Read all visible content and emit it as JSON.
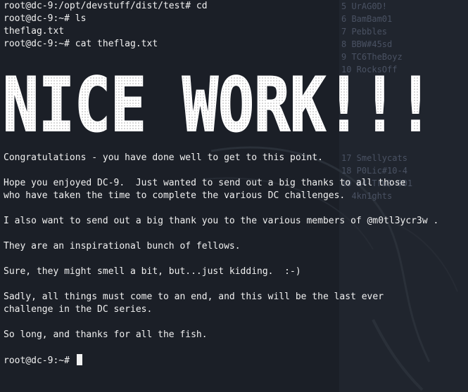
{
  "background_password_list": [
    "5 UrAG0D!",
    "6 BamBam01",
    "7 Pebbles",
    "8 BBW#45sd",
    "9 TC6TheBoyz",
    "10 RocksOff",
    "",
    "",
    "",
    "",
    "",
    "",
    "17 Smellycats",
    "18 P0Lic#10-4",
    "19 B4-Tru3-001",
    "  4kn1ghts"
  ],
  "terminal": {
    "commands": [
      "root@dc-9:/opt/devstuff/dist/test# cd",
      "root@dc-9:~# ls",
      "theflag.txt",
      "root@dc-9:~# cat theflag.txt"
    ],
    "banner_text": "NICE WORK!!!",
    "message": [
      "Congratulations - you have done well to get to this point.",
      "",
      "Hope you enjoyed DC-9.  Just wanted to send out a big thanks to all those",
      "who have taken the time to complete the various DC challenges.",
      "",
      "I also want to send out a big thank you to the various members of @m0tl3ycr3w .",
      "",
      "They are an inspirational bunch of fellows.",
      "",
      "Sure, they might smell a bit, but...just kidding.  :-)",
      "",
      "Sadly, all things must come to an end, and this will be the last ever",
      "challenge in the DC series.",
      "",
      "So long, and thanks for all the fish."
    ],
    "prompt": "root@dc-9:~# "
  },
  "colors": {
    "background": "#1b1f27",
    "foreground": "#f1f1f1",
    "dim_text": "#4a5263"
  }
}
